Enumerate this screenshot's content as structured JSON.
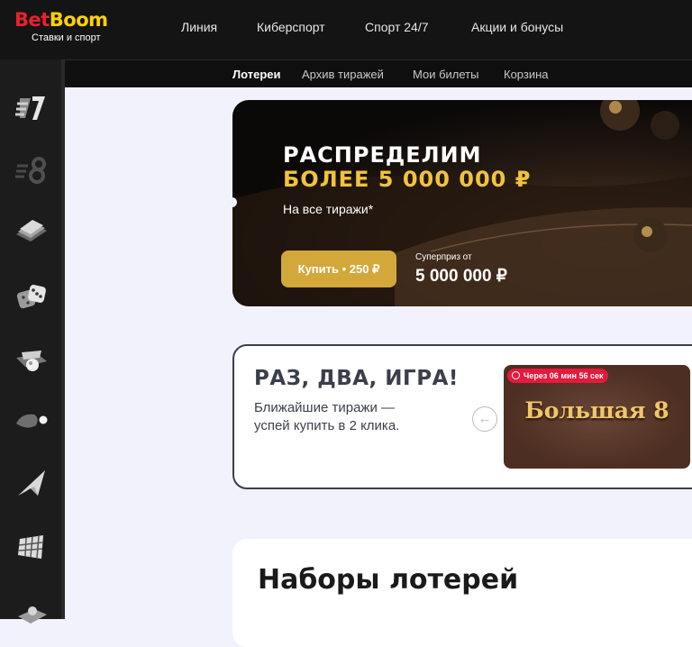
{
  "header": {
    "logo_bet": "Bet",
    "logo_boom": "Boom",
    "logo_tagline": "Ставки и спорт",
    "nav": [
      "Линия",
      "Киберспорт",
      "Спорт 24/7",
      "Акции и бонусы"
    ]
  },
  "subnav": {
    "items": [
      "Лотереи",
      "Архив тиражей",
      "Мои билеты",
      "Корзина"
    ],
    "active": "Лотереи"
  },
  "sidebar": {
    "icons": [
      "lottery-7-icon",
      "lottery-8-icon",
      "ticket-stack-icon",
      "dice-icon",
      "lottery-ball-icon",
      "toggle-ball-icon",
      "paper-plane-icon",
      "scratch-grid-icon",
      "slot-icon"
    ]
  },
  "promo": {
    "title_line1": "РАСПРЕДЕЛИМ",
    "title_line2": "БОЛЕЕ 5 000 000 ₽",
    "subtitle": "На все тиражи*",
    "buy_button": "Купить • 250 ₽",
    "prize_label": "Суперприз от",
    "prize_value": "5 000 000 ₽"
  },
  "quick": {
    "title": "РАЗ, ДВА, ИГРА!",
    "line1": "Ближайшие тиражи —",
    "line2": "успей купить в 2 клика.",
    "prev_icon": "arrow-left-icon",
    "tile_timer": "Через 06 мин 56 сек",
    "tile_name": "Большая 8"
  },
  "sets": {
    "title": "Наборы лотерей"
  },
  "colors": {
    "logo_red": "#e8212d",
    "logo_yellow": "#ffd200",
    "gold": "#d4a73a",
    "timer_red": "#e51a3c"
  }
}
